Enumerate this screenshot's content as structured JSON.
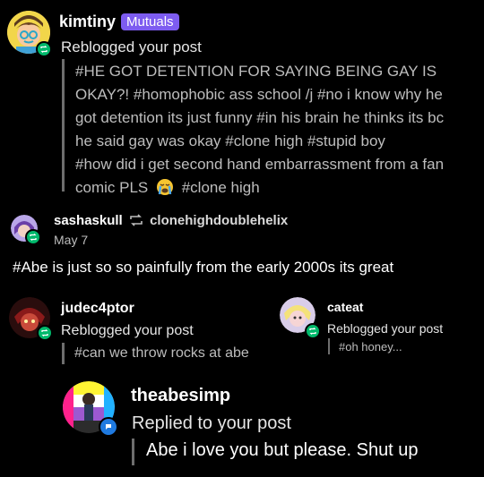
{
  "post1": {
    "username": "kimtiny",
    "badge": "Mutuals",
    "action": "Reblogged your post",
    "tags_lines": [
      "#HE GOT DETENTION FOR SAYING BEING GAY IS",
      "OKAY?! #homophobic ass school /j #no i know why he",
      "got detention its just funny #in his brain he thinks its bc",
      "he said gay was okay #clone high #stupid boy",
      "#how did i get second hand embarrassment from a fan"
    ],
    "tags_last_line_before_emoji": "comic PLS",
    "emoji_name": "loudly-crying-face",
    "tags_last_line_after_emoji": "#clone high",
    "badge_icon": "reblog-icon"
  },
  "post2": {
    "username": "sashaskull",
    "reblog_icon": "reblog-icon",
    "source": "clonehighdoublehelix",
    "date": "May 7",
    "body": "#Abe is just so so painfully from the early 2000s its great",
    "badge_icon": "reblog-icon"
  },
  "post3": {
    "username": "judec4ptor",
    "action": "Reblogged your post",
    "tags": "#can we throw rocks at abe",
    "badge_icon": "reblog-icon"
  },
  "post4": {
    "username": "cateat",
    "action": "Reblogged your post",
    "tags": "#oh honey...",
    "badge_icon": "reblog-icon"
  },
  "post5": {
    "username": "theabesimp",
    "action": "Replied to your post",
    "reply": "Abe i love you but please. Shut up",
    "badge_icon": "reply-icon"
  },
  "colors": {
    "background": "#000000",
    "mutuals_badge": "#7d5cf0",
    "reblog_badge": "#00b86b",
    "reply_badge": "#1f7ae0"
  }
}
